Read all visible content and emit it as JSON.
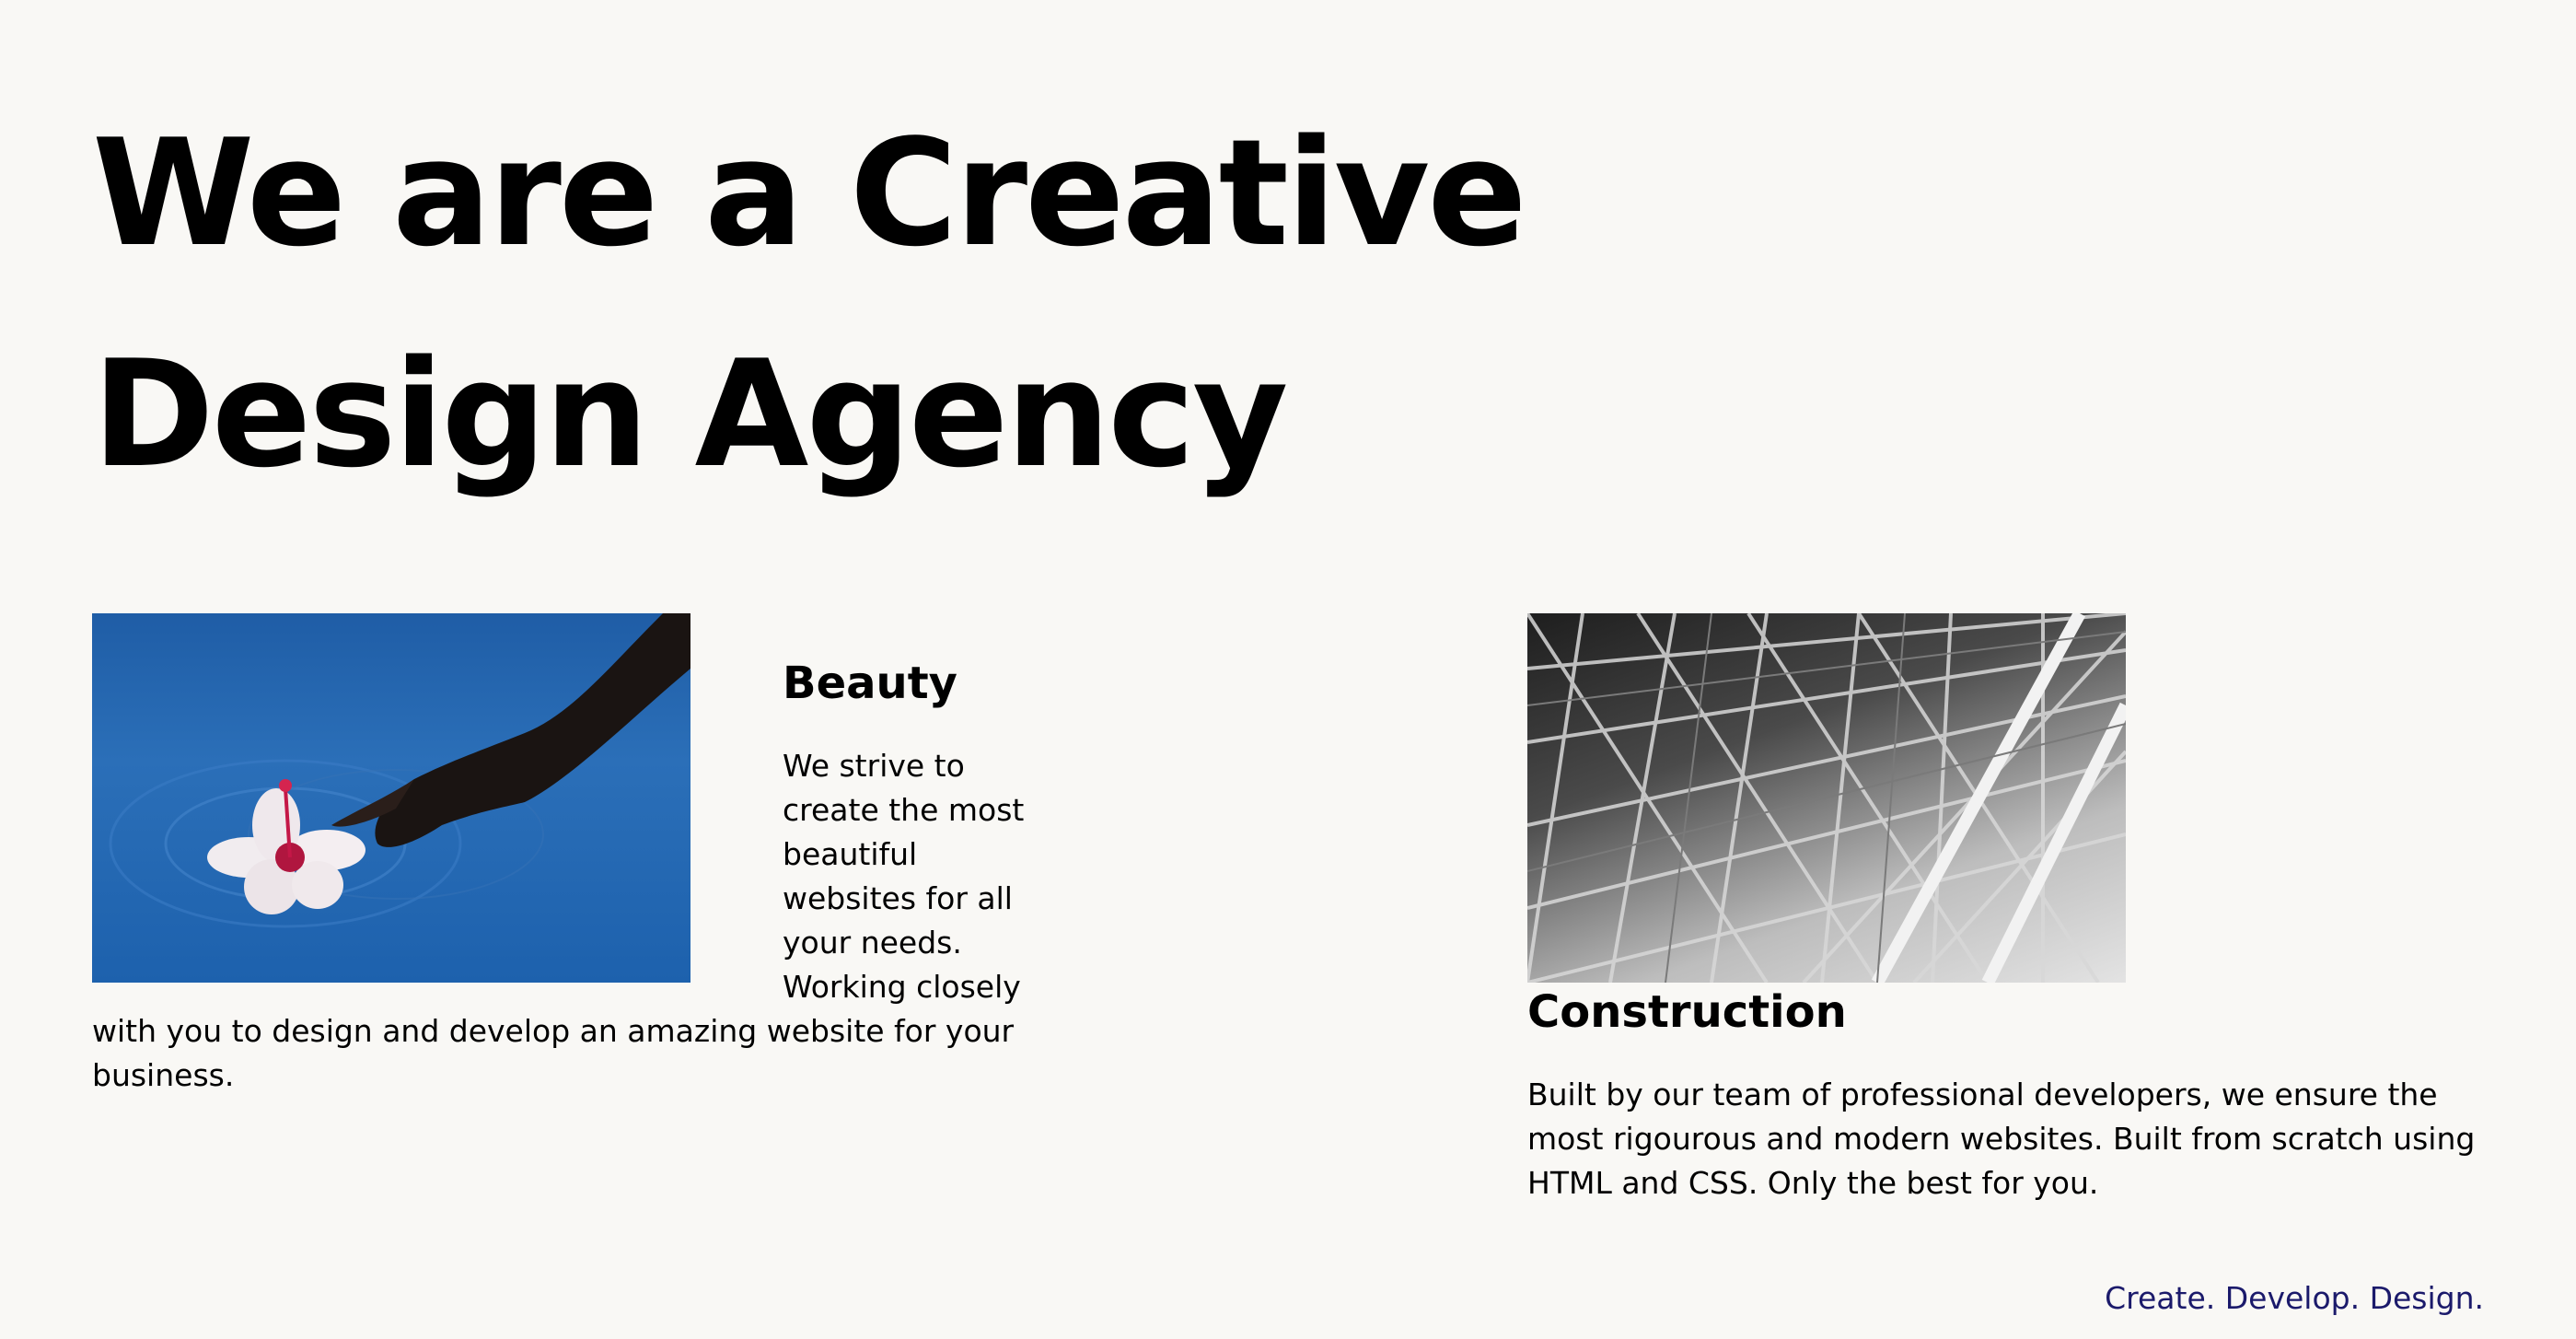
{
  "hero": {
    "title_line1": "We are a Creative",
    "title_line2": "Design Agency"
  },
  "cards": [
    {
      "heading": "Beauty",
      "text": "We strive to create the most beautiful websites for all your needs. Working closely with you to design and develop an amazing website for your business."
    },
    {
      "heading": "Construction",
      "text": "Built by our team of professional developers, we ensure the most rigourous and modern websites. Built from scratch using HTML and CSS. Only the best for you."
    }
  ],
  "footer": {
    "tagline": "Create. Develop. Design."
  },
  "colors": {
    "background": "#f9f8f5",
    "tagline": "#1b1a6b",
    "water": "#1f5da6"
  }
}
